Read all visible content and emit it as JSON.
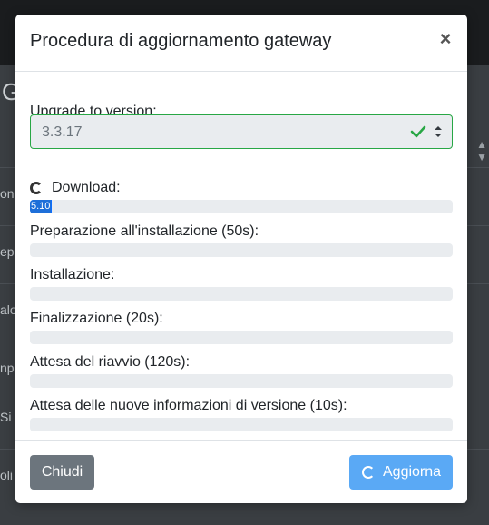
{
  "background": {
    "title_fragment": "G",
    "row_fragments": [
      "on",
      "epa",
      "alo",
      "np",
      "Si",
      "oli"
    ]
  },
  "modal": {
    "title": "Procedura di aggiornamento gateway",
    "close_glyph": "×",
    "version_label": "Upgrade to version:",
    "version_value": "3.3.17",
    "steps": [
      {
        "label": "Download:",
        "progress_text": "5.10",
        "progress": 0.051,
        "in_progress": true
      },
      {
        "label": "Preparazione all'installazione (50s):",
        "progress": 0
      },
      {
        "label": "Installazione:",
        "progress": 0
      },
      {
        "label": "Finalizzazione (20s):",
        "progress": 0
      },
      {
        "label": "Attesa del riavvio (120s):",
        "progress": 0
      },
      {
        "label": "Attesa delle nuove informazioni di versione (10s):",
        "progress": 0
      }
    ],
    "buttons": {
      "close_label": "Chiudi",
      "update_label": "Aggiorna"
    },
    "colors": {
      "valid_border": "#28a745",
      "close_button": "#6c757d",
      "update_button": "#5aa9f5"
    }
  }
}
